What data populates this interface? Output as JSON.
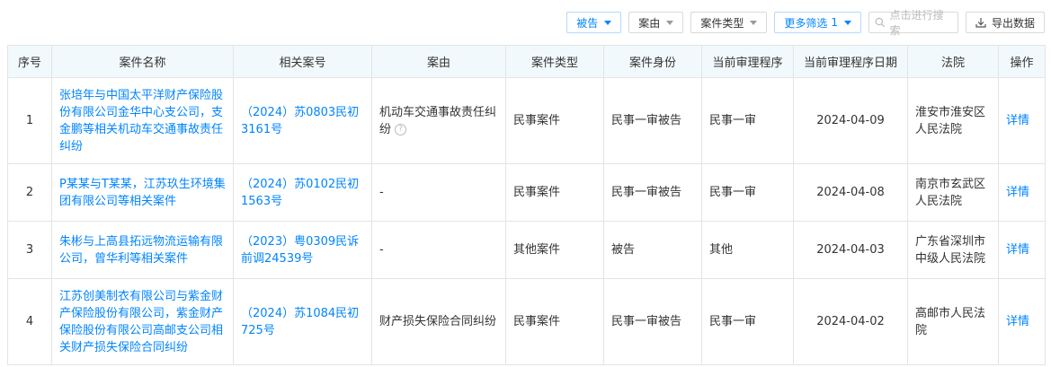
{
  "toolbar": {
    "filter_role": "被告",
    "filter_cause": "案由",
    "filter_type": "案件类型",
    "more_filters": "更多筛选",
    "more_filters_count": "1",
    "search_placeholder": "点击进行搜索",
    "export_label": "导出数据"
  },
  "table": {
    "headers": [
      "序号",
      "案件名称",
      "相关案号",
      "案由",
      "案件类型",
      "案件身份",
      "当前审理程序",
      "当前审理程序日期",
      "法院",
      "操作"
    ],
    "rows": [
      {
        "index": "1",
        "case_name": "张培年与中国太平洋财产保险股份有限公司金华中心支公司，支金鹏等相关机动车交通事故责任纠纷",
        "case_no": "（2024）苏0803民初3161号",
        "cause": "机动车交通事故责任纠纷",
        "case_type": "民事案件",
        "role": "民事一审被告",
        "procedure": "民事一审",
        "date": "2024-04-09",
        "court": "淮安市淮安区人民法院",
        "action": "详情"
      },
      {
        "index": "2",
        "case_name": "P某某与T某某，江苏玖生环境集团有限公司等相关案件",
        "case_no": "（2024）苏0102民初1563号",
        "cause": "-",
        "case_type": "民事案件",
        "role": "民事一审被告",
        "procedure": "民事一审",
        "date": "2024-04-08",
        "court": "南京市玄武区人民法院",
        "action": "详情"
      },
      {
        "index": "3",
        "case_name": "朱彬与上高县拓远物流运输有限公司，曾华利等相关案件",
        "case_no": "（2023）粤0309民诉前调24539号",
        "cause": "-",
        "case_type": "其他案件",
        "role": "被告",
        "procedure": "其他",
        "date": "2024-04-03",
        "court": "广东省深圳市中级人民法院",
        "action": "详情"
      },
      {
        "index": "4",
        "case_name": "江苏创美制衣有限公司与紫金财产保险股份有限公司，紫金财产保险股份有限公司高邮支公司相关财产损失保险合同纠纷",
        "case_no": "（2024）苏1084民初725号",
        "cause": "财产损失保险合同纠纷",
        "case_type": "民事案件",
        "role": "民事一审被告",
        "procedure": "民事一审",
        "date": "2024-04-02",
        "court": "高邮市人民法院",
        "action": "详情"
      }
    ]
  },
  "colors": {
    "accent": "#0084ff",
    "header_bg": "#f2f9fc",
    "border": "#e4e4e4"
  }
}
